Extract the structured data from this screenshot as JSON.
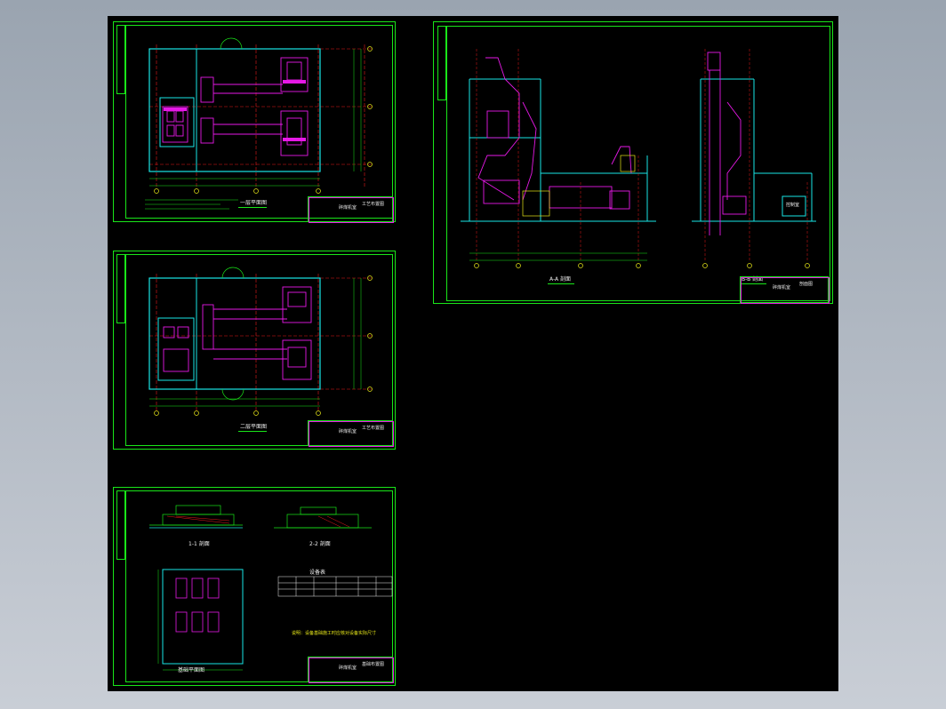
{
  "sheets": [
    {
      "caption": "一层平面图",
      "tb_title": "碎煤机室",
      "tb_sub": "工艺布置图"
    },
    {
      "caption": "二层平面图",
      "tb_title": "碎煤机室",
      "tb_sub": "工艺布置图"
    },
    {
      "caption_a": "1-1 剖面",
      "caption_b": "2-2 剖面",
      "caption_c": "基础平面图",
      "table_title": "设备表",
      "note": "说明：设备基础施工时应核对设备实际尺寸",
      "tb_title": "碎煤机室",
      "tb_sub": "基础布置图"
    },
    {
      "caption_a": "A-A 剖面",
      "caption_b": "B-B 剖面",
      "room_label": "控制室",
      "tb_title": "碎煤机室",
      "tb_sub": "剖面图"
    }
  ]
}
